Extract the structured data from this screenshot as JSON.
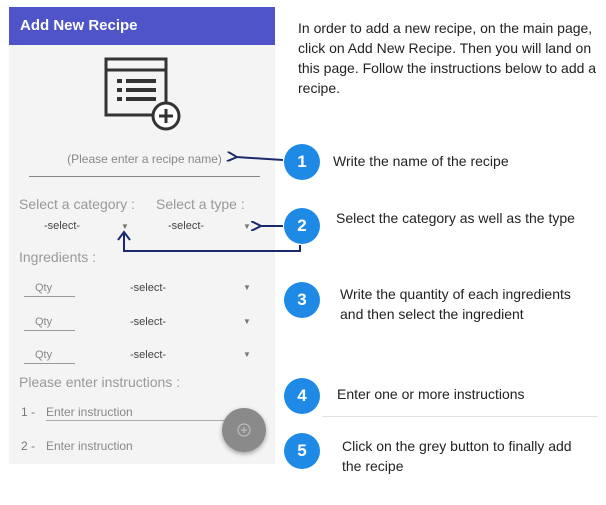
{
  "app": {
    "title": "Add New Recipe",
    "name_placeholder": "(Please enter a recipe name)",
    "category_label": "Select a category :",
    "type_label": "Select a type :",
    "category_value": "-select-",
    "type_value": "-select-",
    "ingredients_label": "Ingredients :",
    "ingredients": [
      {
        "qty_placeholder": "Qty",
        "select_value": "-select-"
      },
      {
        "qty_placeholder": "Qty",
        "select_value": "-select-"
      },
      {
        "qty_placeholder": "Qty",
        "select_value": "-select-"
      }
    ],
    "instructions_label": "Please enter instructions :",
    "instructions": [
      {
        "number": "1 -",
        "placeholder": "Enter instruction"
      },
      {
        "number": "2 -",
        "placeholder": "Enter instruction"
      }
    ],
    "fab_icon": "plus-icon",
    "colors": {
      "appbar": "#4f55c8",
      "step_circle": "#1f8ae6",
      "fab": "#8a8a8a"
    }
  },
  "tutorial": {
    "intro": "In order to add a new recipe, on the main page, click on Add New Recipe. Then you will land on this page. Follow the instructions below to add a recipe.",
    "steps": [
      {
        "number": "1",
        "text": "Write the name of the recipe"
      },
      {
        "number": "2",
        "text": "Select the category as well as the type"
      },
      {
        "number": "3",
        "text": "Write the quantity of each ingredients and then select the ingredient"
      },
      {
        "number": "4",
        "text": "Enter one or more instructions"
      },
      {
        "number": "5",
        "text": "Click on the grey button to finally add the recipe"
      }
    ]
  }
}
